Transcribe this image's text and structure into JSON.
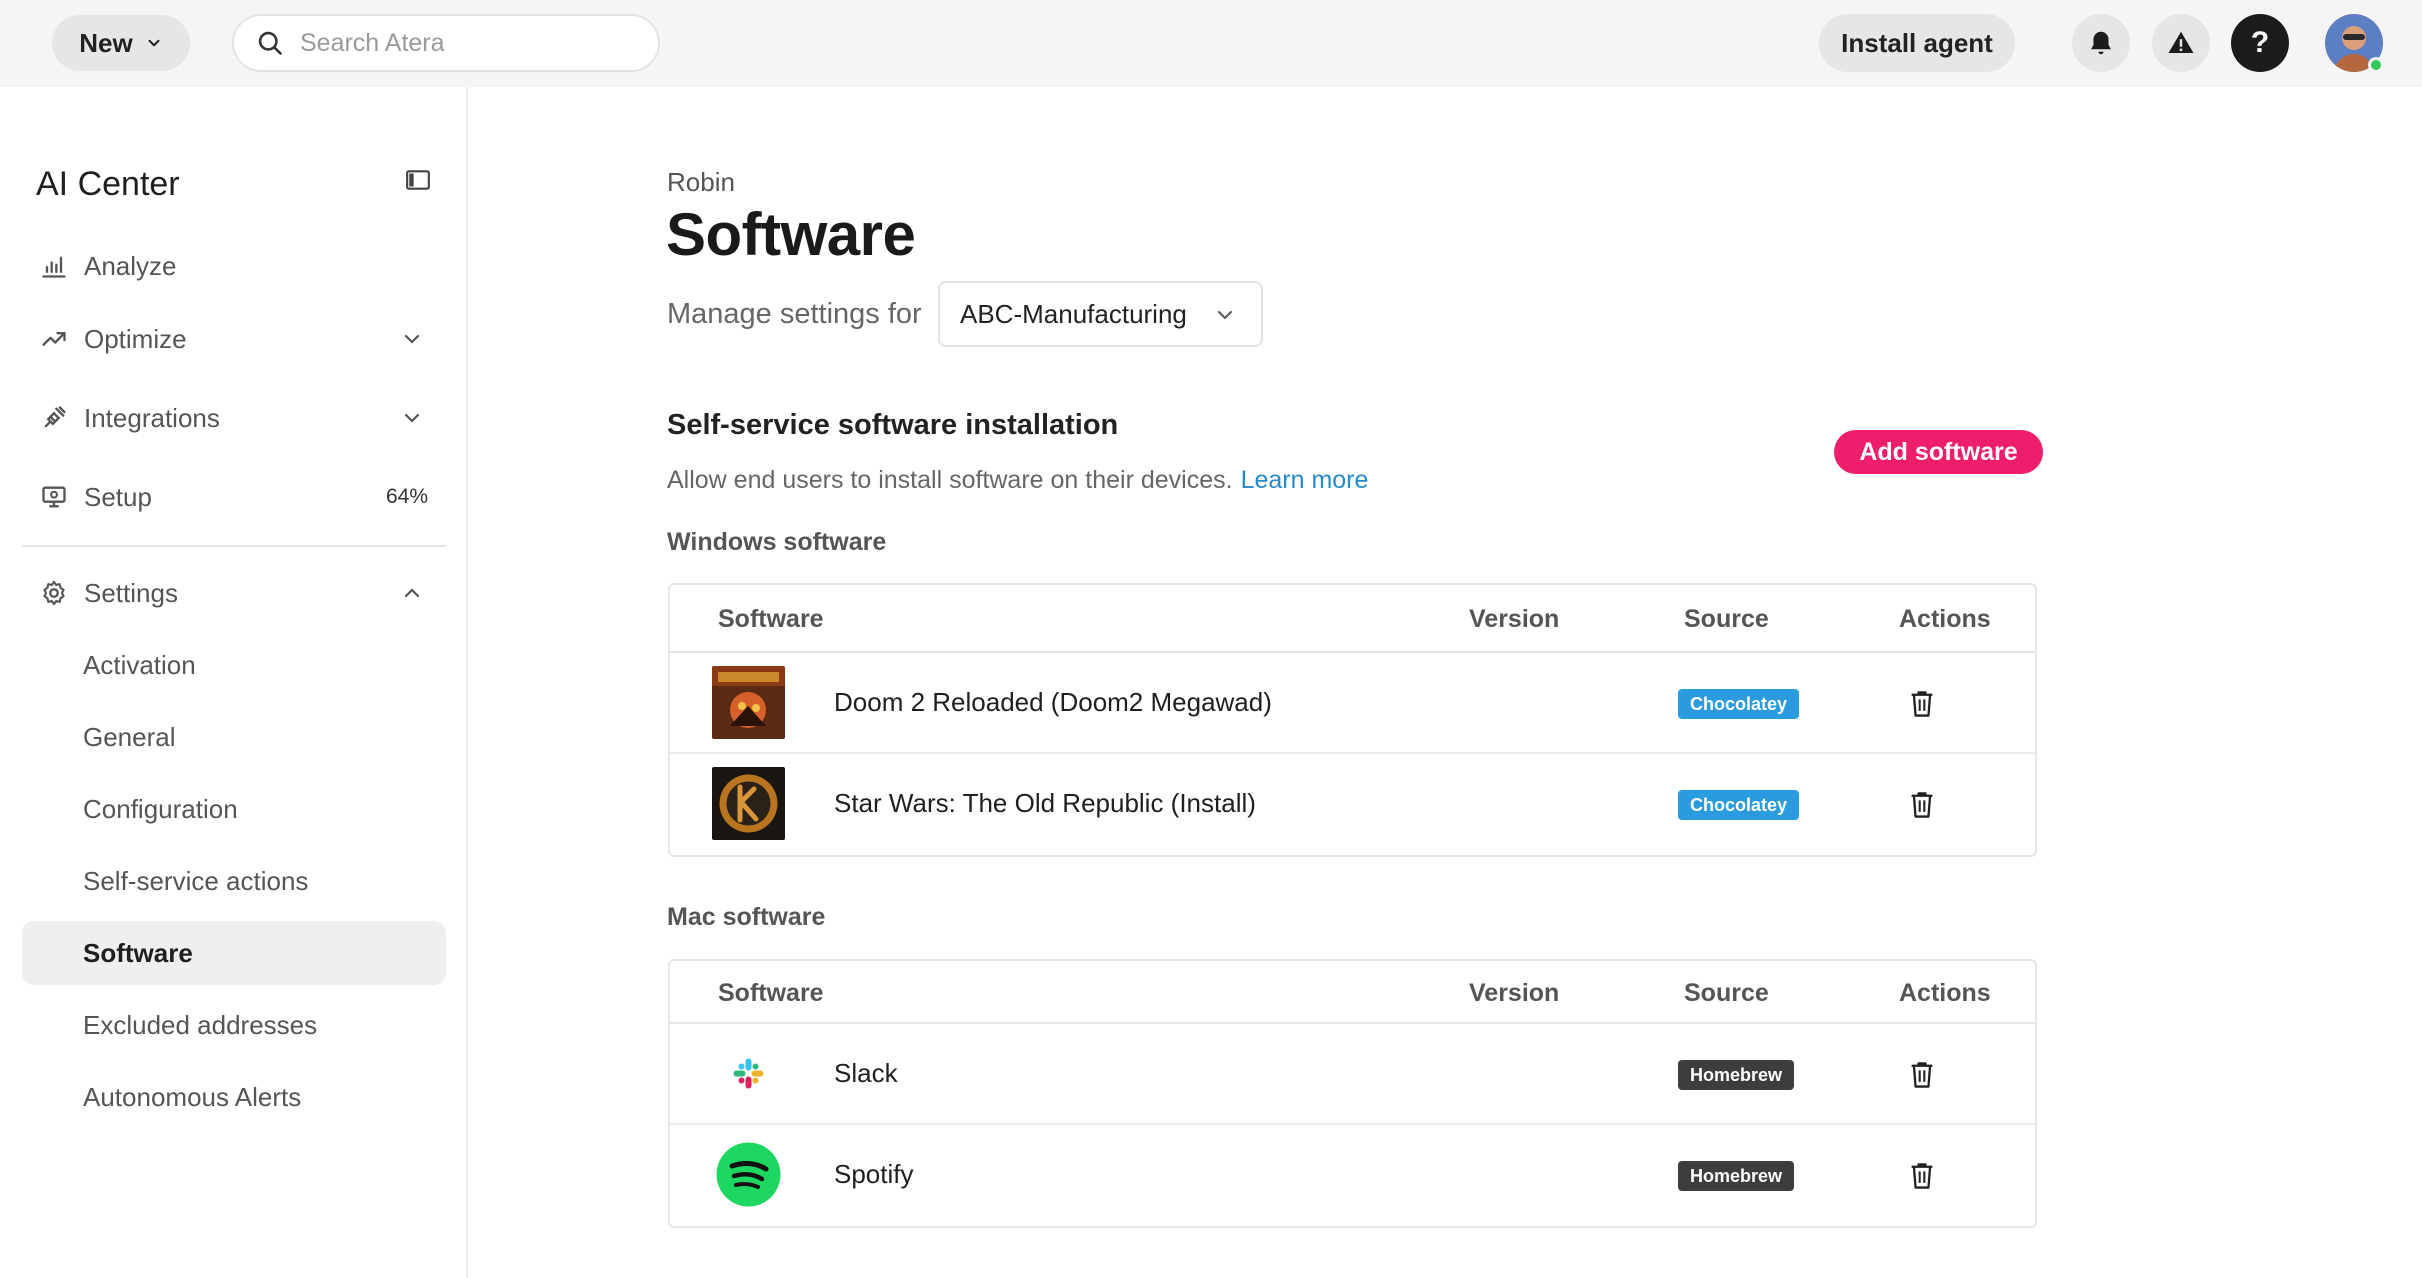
{
  "topbar": {
    "new_label": "New",
    "search_placeholder": "Search Atera",
    "install_label": "Install agent",
    "help_label": "?"
  },
  "sidebar": {
    "title": "AI Center",
    "items": [
      {
        "label": "Analyze",
        "icon": "bar-chart-icon"
      },
      {
        "label": "Optimize",
        "icon": "trending-up-icon"
      },
      {
        "label": "Integrations",
        "icon": "plug-icon"
      },
      {
        "label": "Setup",
        "icon": "monitor-icon",
        "progress": "64%"
      },
      {
        "label": "Settings",
        "icon": "gear-icon"
      }
    ],
    "settings_sub": [
      "Activation",
      "General",
      "Configuration",
      "Self-service actions",
      "Software",
      "Excluded addresses",
      "Autonomous Alerts"
    ]
  },
  "main": {
    "breadcrumb": "Robin",
    "title": "Software",
    "manage_label": "Manage settings for",
    "selected_customer": "ABC-Manufacturing",
    "section_title": "Self-service software installation",
    "section_desc": "Allow end users to install software on their devices.",
    "learn_more": "Learn more",
    "add_button": "Add software",
    "columns": {
      "software": "Software",
      "version": "Version",
      "source": "Source",
      "actions": "Actions"
    },
    "windows": {
      "title": "Windows software",
      "rows": [
        {
          "name": "Doom 2 Reloaded (Doom2 Megawad)",
          "version": "",
          "source": "Chocolatey"
        },
        {
          "name": "Star Wars: The Old Republic (Install)",
          "version": "",
          "source": "Chocolatey"
        }
      ]
    },
    "mac": {
      "title": "Mac software",
      "rows": [
        {
          "name": "Slack",
          "version": "",
          "source": "Homebrew"
        },
        {
          "name": "Spotify",
          "version": "",
          "source": "Homebrew"
        }
      ]
    }
  },
  "colors": {
    "accent": "#ee1e6d",
    "link": "#2a8ac9",
    "chocolatey": "#2b9be0",
    "homebrew": "#3d3d3d",
    "online": "#34c759"
  }
}
